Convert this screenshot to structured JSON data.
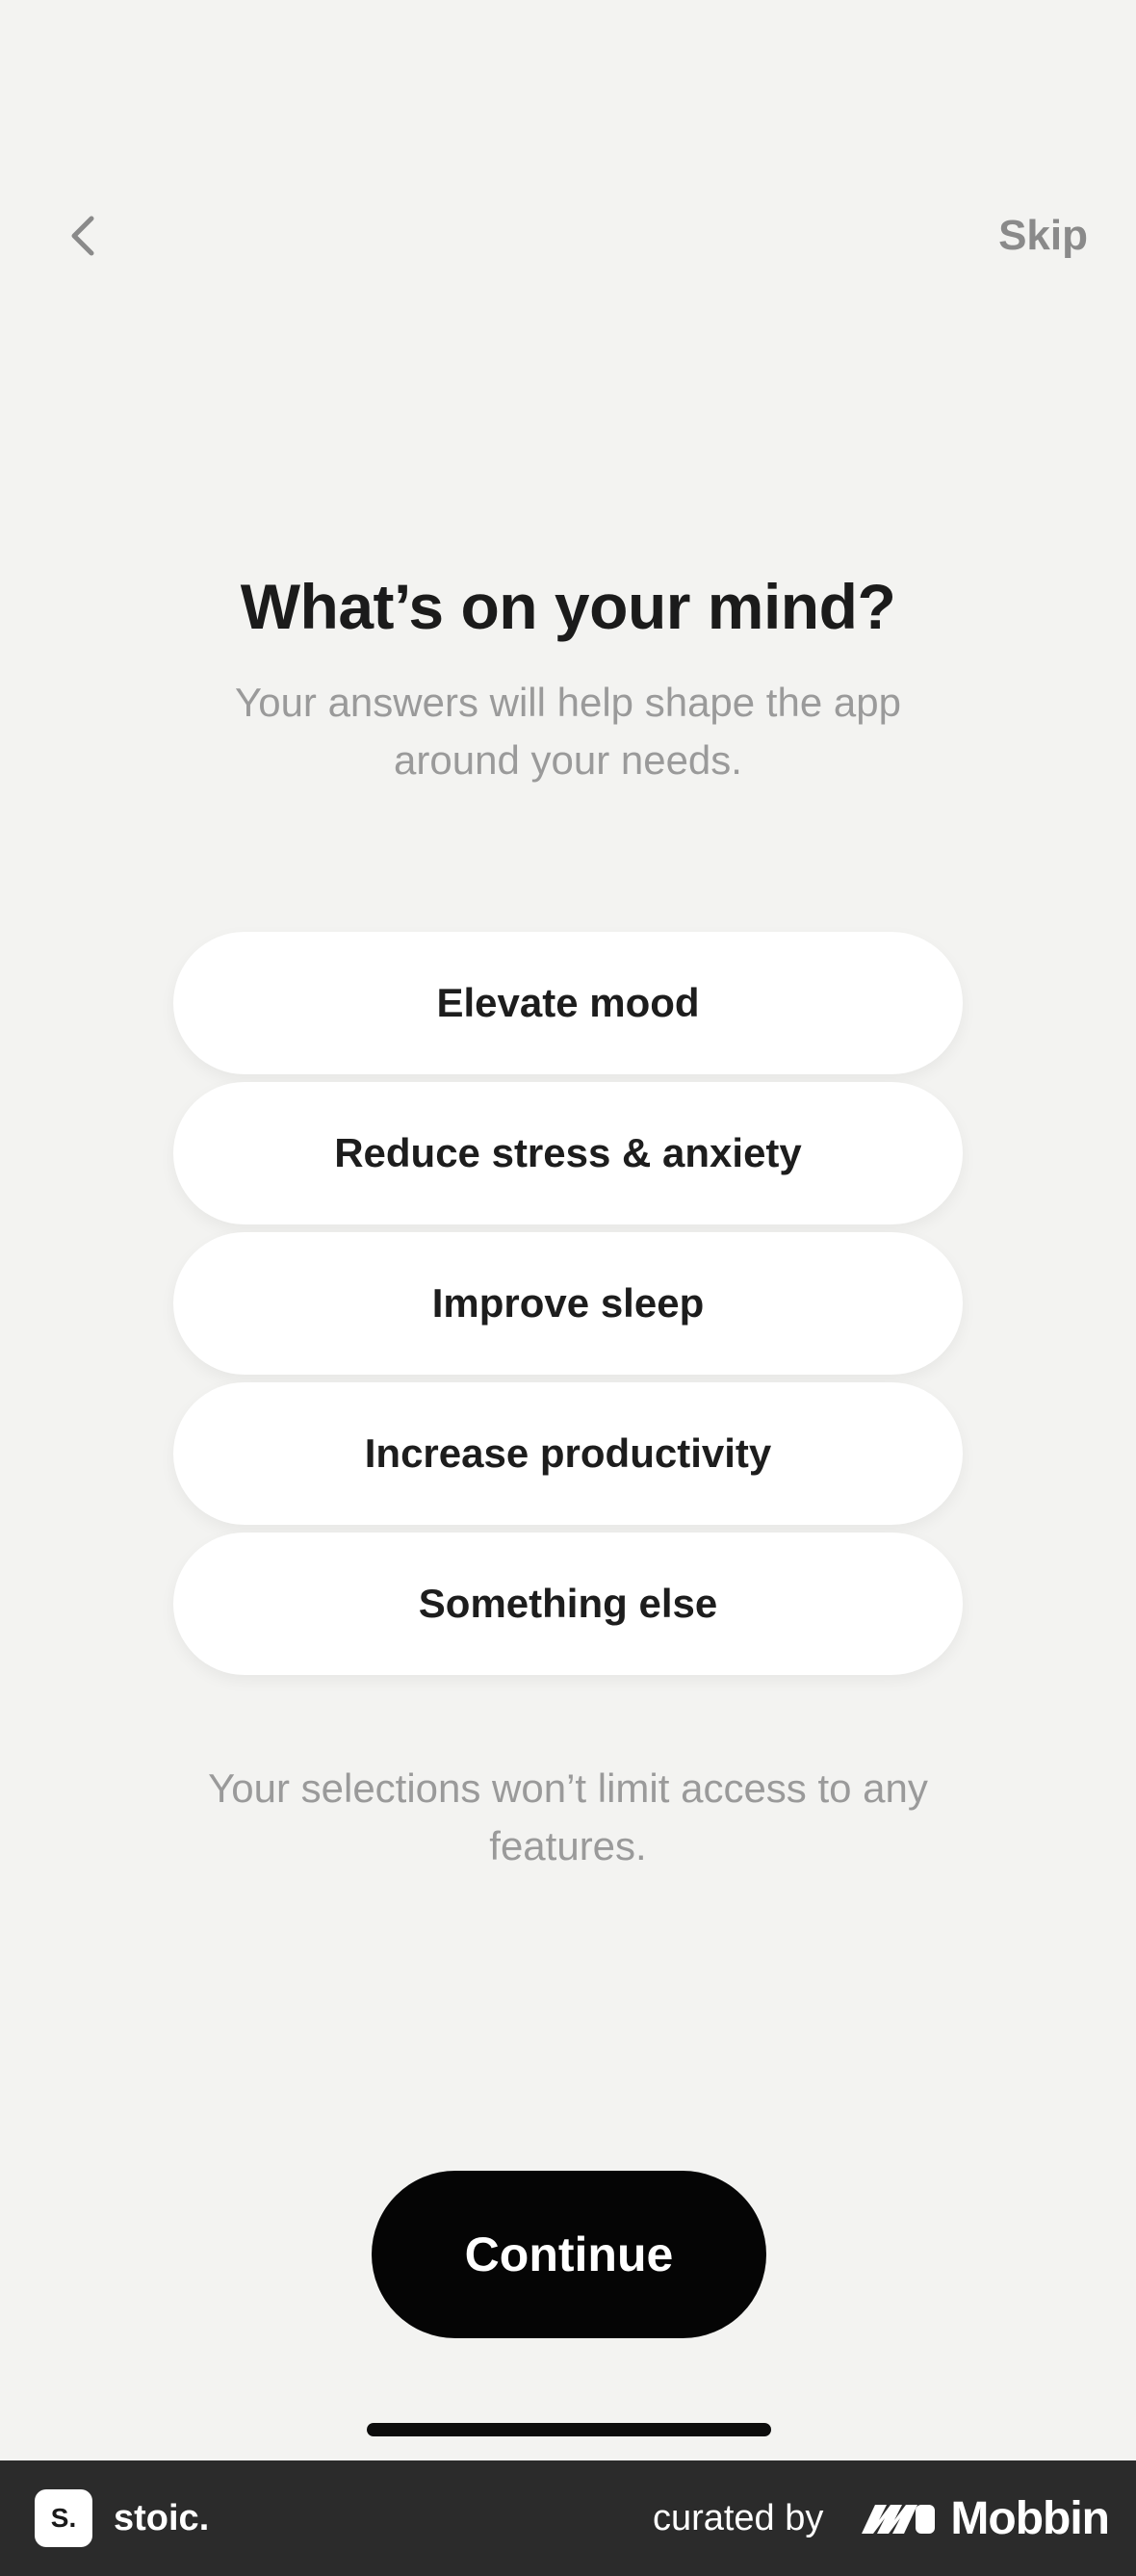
{
  "header": {
    "back_icon": "chevron-left-icon",
    "skip_label": "Skip"
  },
  "main": {
    "title": "What’s on your mind?",
    "subtitle": "Your answers will help shape the app around your needs.",
    "options": [
      {
        "label": "Elevate mood"
      },
      {
        "label": "Reduce stress & anxiety"
      },
      {
        "label": "Improve sleep"
      },
      {
        "label": "Increase productivity"
      },
      {
        "label": "Something else"
      }
    ],
    "note": "Your selections won’t limit access to any features.",
    "continue_label": "Continue"
  },
  "footer": {
    "app_logo_text": "S.",
    "app_name": "stoic.",
    "curated_label": "curated by",
    "brand_icon": "mobbin-logo-icon",
    "brand_name": "Mobbin"
  },
  "colors": {
    "background": "#f3f3f1",
    "option_bg": "#ffffff",
    "primary_button": "#050505",
    "muted_text": "#9a9a9a",
    "footer_bg": "#2b2b2b"
  }
}
